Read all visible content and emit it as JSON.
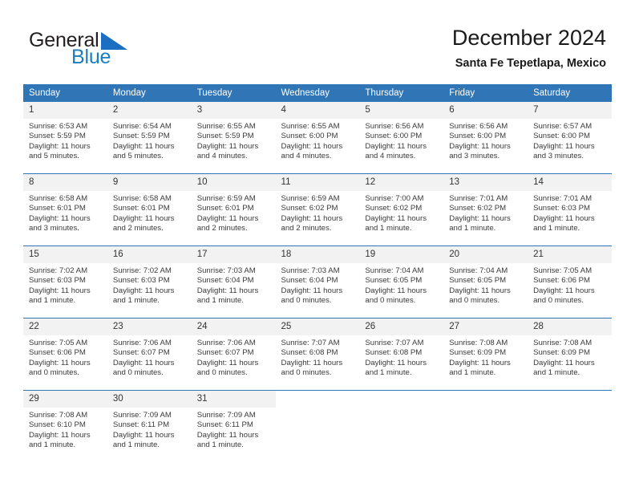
{
  "brand": {
    "name_primary": "General",
    "name_secondary": "Blue",
    "triangle_icon": "triangle-icon"
  },
  "header": {
    "title": "December 2024",
    "subtitle": "Santa Fe Tepetlapa, Mexico"
  },
  "colors": {
    "header_blue": "#3075b5",
    "brand_blue": "#1b7ec2",
    "daynum_band": "#f2f2f2",
    "text": "#3a3a3a"
  },
  "weekday_headers": [
    "Sunday",
    "Monday",
    "Tuesday",
    "Wednesday",
    "Thursday",
    "Friday",
    "Saturday"
  ],
  "labels": {
    "sunrise_prefix": "Sunrise:",
    "sunset_prefix": "Sunset:",
    "daylight_prefix": "Daylight:"
  },
  "weeks": [
    [
      {
        "day": "1",
        "sunrise": "Sunrise: 6:53 AM",
        "sunset": "Sunset: 5:59 PM",
        "daylight_line1": "Daylight: 11 hours",
        "daylight_line2": "and 5 minutes."
      },
      {
        "day": "2",
        "sunrise": "Sunrise: 6:54 AM",
        "sunset": "Sunset: 5:59 PM",
        "daylight_line1": "Daylight: 11 hours",
        "daylight_line2": "and 5 minutes."
      },
      {
        "day": "3",
        "sunrise": "Sunrise: 6:55 AM",
        "sunset": "Sunset: 5:59 PM",
        "daylight_line1": "Daylight: 11 hours",
        "daylight_line2": "and 4 minutes."
      },
      {
        "day": "4",
        "sunrise": "Sunrise: 6:55 AM",
        "sunset": "Sunset: 6:00 PM",
        "daylight_line1": "Daylight: 11 hours",
        "daylight_line2": "and 4 minutes."
      },
      {
        "day": "5",
        "sunrise": "Sunrise: 6:56 AM",
        "sunset": "Sunset: 6:00 PM",
        "daylight_line1": "Daylight: 11 hours",
        "daylight_line2": "and 4 minutes."
      },
      {
        "day": "6",
        "sunrise": "Sunrise: 6:56 AM",
        "sunset": "Sunset: 6:00 PM",
        "daylight_line1": "Daylight: 11 hours",
        "daylight_line2": "and 3 minutes."
      },
      {
        "day": "7",
        "sunrise": "Sunrise: 6:57 AM",
        "sunset": "Sunset: 6:00 PM",
        "daylight_line1": "Daylight: 11 hours",
        "daylight_line2": "and 3 minutes."
      }
    ],
    [
      {
        "day": "8",
        "sunrise": "Sunrise: 6:58 AM",
        "sunset": "Sunset: 6:01 PM",
        "daylight_line1": "Daylight: 11 hours",
        "daylight_line2": "and 3 minutes."
      },
      {
        "day": "9",
        "sunrise": "Sunrise: 6:58 AM",
        "sunset": "Sunset: 6:01 PM",
        "daylight_line1": "Daylight: 11 hours",
        "daylight_line2": "and 2 minutes."
      },
      {
        "day": "10",
        "sunrise": "Sunrise: 6:59 AM",
        "sunset": "Sunset: 6:01 PM",
        "daylight_line1": "Daylight: 11 hours",
        "daylight_line2": "and 2 minutes."
      },
      {
        "day": "11",
        "sunrise": "Sunrise: 6:59 AM",
        "sunset": "Sunset: 6:02 PM",
        "daylight_line1": "Daylight: 11 hours",
        "daylight_line2": "and 2 minutes."
      },
      {
        "day": "12",
        "sunrise": "Sunrise: 7:00 AM",
        "sunset": "Sunset: 6:02 PM",
        "daylight_line1": "Daylight: 11 hours",
        "daylight_line2": "and 1 minute."
      },
      {
        "day": "13",
        "sunrise": "Sunrise: 7:01 AM",
        "sunset": "Sunset: 6:02 PM",
        "daylight_line1": "Daylight: 11 hours",
        "daylight_line2": "and 1 minute."
      },
      {
        "day": "14",
        "sunrise": "Sunrise: 7:01 AM",
        "sunset": "Sunset: 6:03 PM",
        "daylight_line1": "Daylight: 11 hours",
        "daylight_line2": "and 1 minute."
      }
    ],
    [
      {
        "day": "15",
        "sunrise": "Sunrise: 7:02 AM",
        "sunset": "Sunset: 6:03 PM",
        "daylight_line1": "Daylight: 11 hours",
        "daylight_line2": "and 1 minute."
      },
      {
        "day": "16",
        "sunrise": "Sunrise: 7:02 AM",
        "sunset": "Sunset: 6:03 PM",
        "daylight_line1": "Daylight: 11 hours",
        "daylight_line2": "and 1 minute."
      },
      {
        "day": "17",
        "sunrise": "Sunrise: 7:03 AM",
        "sunset": "Sunset: 6:04 PM",
        "daylight_line1": "Daylight: 11 hours",
        "daylight_line2": "and 1 minute."
      },
      {
        "day": "18",
        "sunrise": "Sunrise: 7:03 AM",
        "sunset": "Sunset: 6:04 PM",
        "daylight_line1": "Daylight: 11 hours",
        "daylight_line2": "and 0 minutes."
      },
      {
        "day": "19",
        "sunrise": "Sunrise: 7:04 AM",
        "sunset": "Sunset: 6:05 PM",
        "daylight_line1": "Daylight: 11 hours",
        "daylight_line2": "and 0 minutes."
      },
      {
        "day": "20",
        "sunrise": "Sunrise: 7:04 AM",
        "sunset": "Sunset: 6:05 PM",
        "daylight_line1": "Daylight: 11 hours",
        "daylight_line2": "and 0 minutes."
      },
      {
        "day": "21",
        "sunrise": "Sunrise: 7:05 AM",
        "sunset": "Sunset: 6:06 PM",
        "daylight_line1": "Daylight: 11 hours",
        "daylight_line2": "and 0 minutes."
      }
    ],
    [
      {
        "day": "22",
        "sunrise": "Sunrise: 7:05 AM",
        "sunset": "Sunset: 6:06 PM",
        "daylight_line1": "Daylight: 11 hours",
        "daylight_line2": "and 0 minutes."
      },
      {
        "day": "23",
        "sunrise": "Sunrise: 7:06 AM",
        "sunset": "Sunset: 6:07 PM",
        "daylight_line1": "Daylight: 11 hours",
        "daylight_line2": "and 0 minutes."
      },
      {
        "day": "24",
        "sunrise": "Sunrise: 7:06 AM",
        "sunset": "Sunset: 6:07 PM",
        "daylight_line1": "Daylight: 11 hours",
        "daylight_line2": "and 0 minutes."
      },
      {
        "day": "25",
        "sunrise": "Sunrise: 7:07 AM",
        "sunset": "Sunset: 6:08 PM",
        "daylight_line1": "Daylight: 11 hours",
        "daylight_line2": "and 0 minutes."
      },
      {
        "day": "26",
        "sunrise": "Sunrise: 7:07 AM",
        "sunset": "Sunset: 6:08 PM",
        "daylight_line1": "Daylight: 11 hours",
        "daylight_line2": "and 1 minute."
      },
      {
        "day": "27",
        "sunrise": "Sunrise: 7:08 AM",
        "sunset": "Sunset: 6:09 PM",
        "daylight_line1": "Daylight: 11 hours",
        "daylight_line2": "and 1 minute."
      },
      {
        "day": "28",
        "sunrise": "Sunrise: 7:08 AM",
        "sunset": "Sunset: 6:09 PM",
        "daylight_line1": "Daylight: 11 hours",
        "daylight_line2": "and 1 minute."
      }
    ],
    [
      {
        "day": "29",
        "sunrise": "Sunrise: 7:08 AM",
        "sunset": "Sunset: 6:10 PM",
        "daylight_line1": "Daylight: 11 hours",
        "daylight_line2": "and 1 minute."
      },
      {
        "day": "30",
        "sunrise": "Sunrise: 7:09 AM",
        "sunset": "Sunset: 6:11 PM",
        "daylight_line1": "Daylight: 11 hours",
        "daylight_line2": "and 1 minute."
      },
      {
        "day": "31",
        "sunrise": "Sunrise: 7:09 AM",
        "sunset": "Sunset: 6:11 PM",
        "daylight_line1": "Daylight: 11 hours",
        "daylight_line2": "and 1 minute."
      },
      {
        "day": "",
        "sunrise": "",
        "sunset": "",
        "daylight_line1": "",
        "daylight_line2": ""
      },
      {
        "day": "",
        "sunrise": "",
        "sunset": "",
        "daylight_line1": "",
        "daylight_line2": ""
      },
      {
        "day": "",
        "sunrise": "",
        "sunset": "",
        "daylight_line1": "",
        "daylight_line2": ""
      },
      {
        "day": "",
        "sunrise": "",
        "sunset": "",
        "daylight_line1": "",
        "daylight_line2": ""
      }
    ]
  ]
}
